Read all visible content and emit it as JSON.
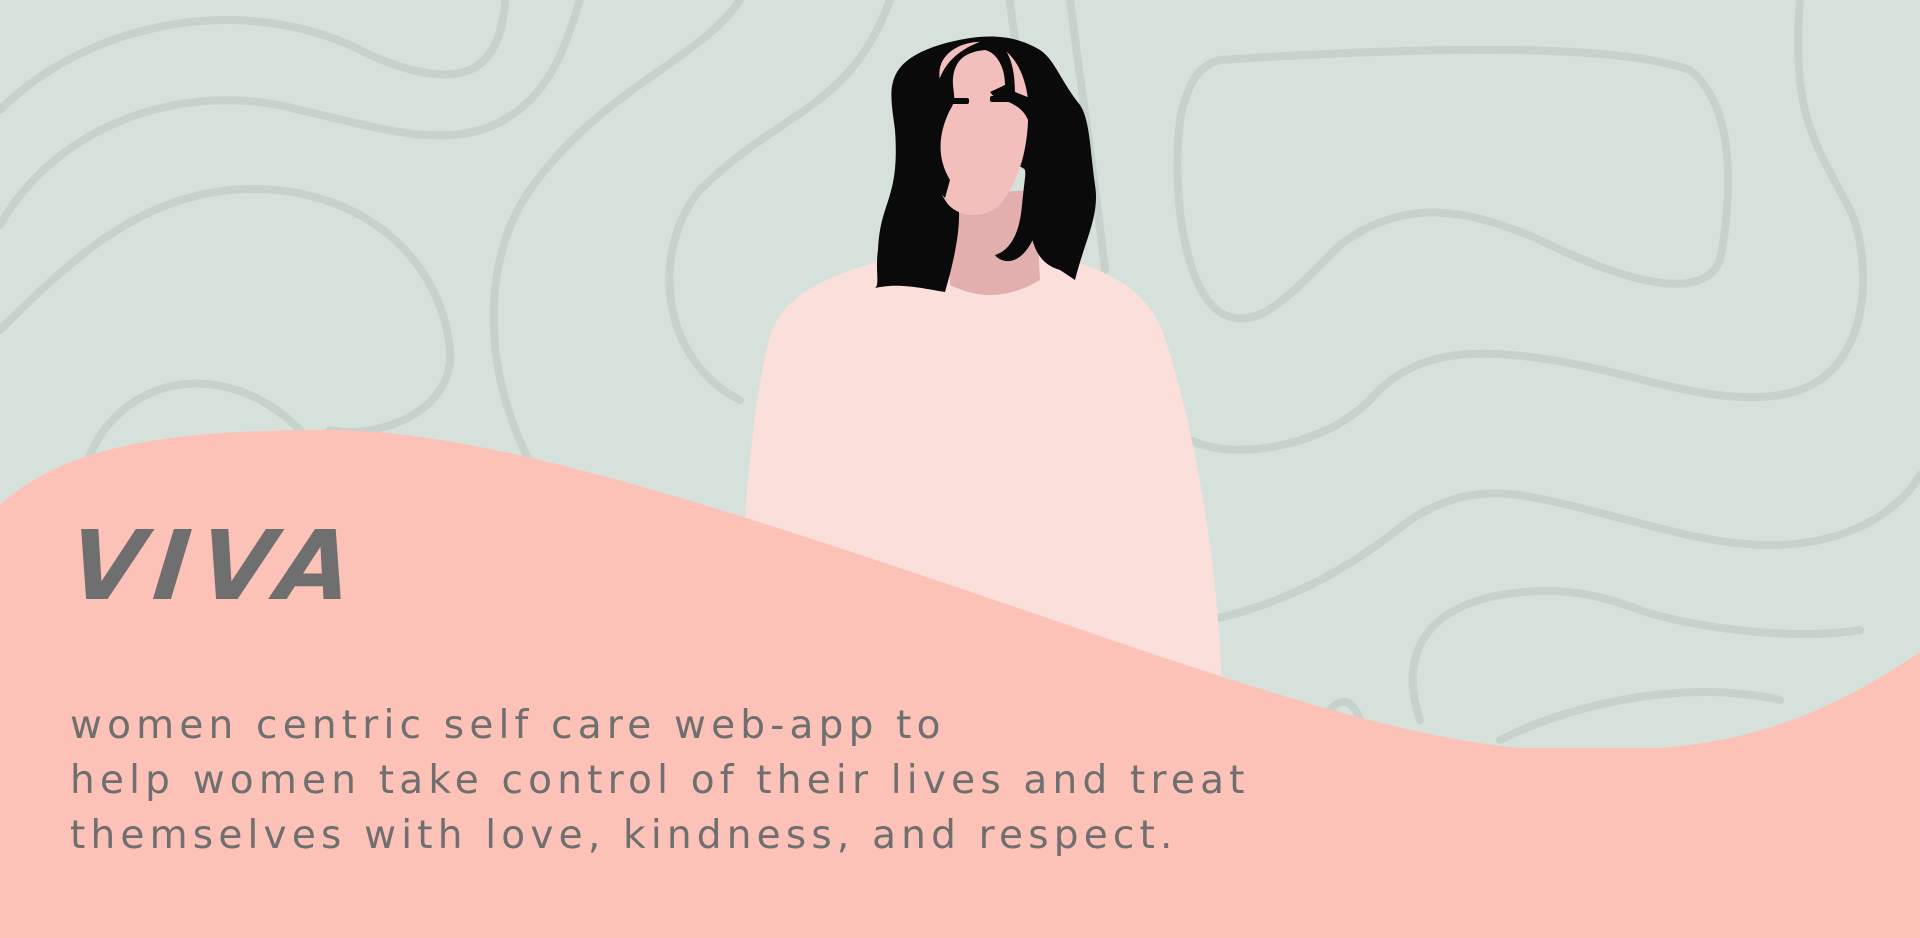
{
  "app": {
    "title": "VIVA",
    "tagline_lines": [
      "women centric self care web-app to",
      "help women take control of their lives and treat",
      "themselves with love, kindness, and respect."
    ]
  },
  "colors": {
    "background": "#d7e1dc",
    "contour_lines": "#c8d2cd",
    "wave": "#fdc2b7",
    "sweater": "#fbdfdb",
    "skin": "#f3bfbd",
    "skin_shadow": "#e2aeae",
    "hair": "#0a0a0a",
    "text": "#6f6f6f"
  },
  "illustration": {
    "subject": "woman-with-black-hair-in-pink-sweater",
    "background_pattern": "topographic-contour-lines"
  }
}
